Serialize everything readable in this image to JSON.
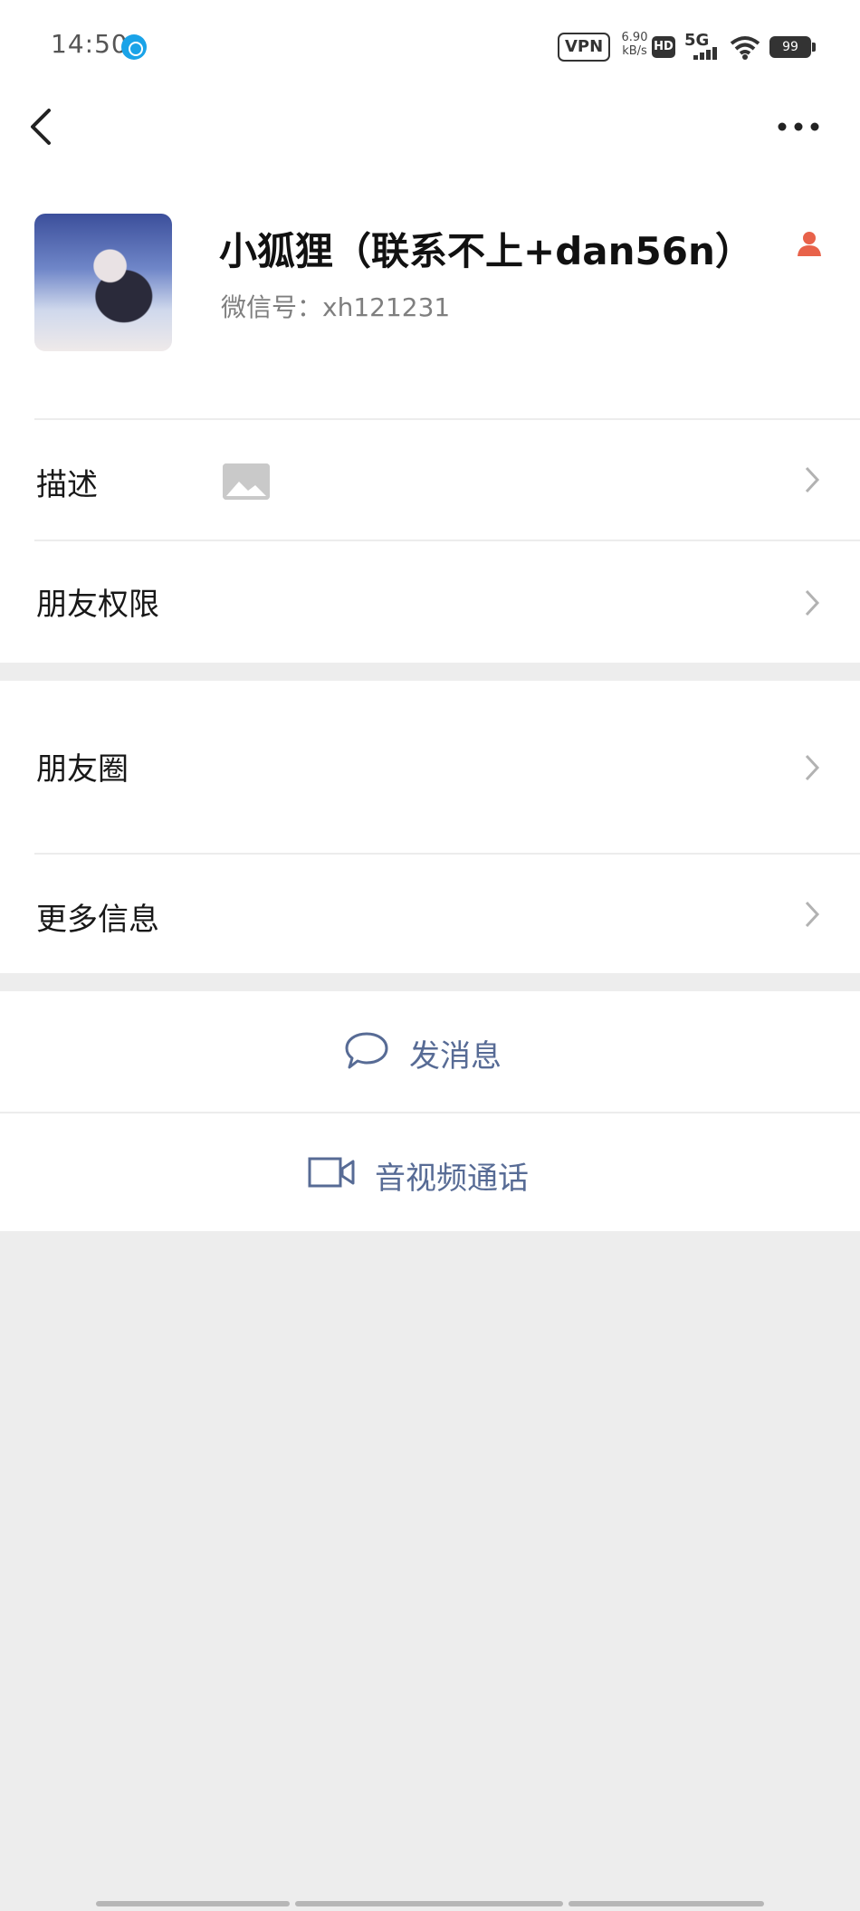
{
  "status_bar": {
    "time": "14:50",
    "vpn": "VPN",
    "speed": "6.90",
    "speed_unit": "kB/s",
    "hd": "HD",
    "network": "5G",
    "battery": "99"
  },
  "profile": {
    "name": "小狐狸（联系不上+dan56n）",
    "wechat_id": "微信号：xh121231"
  },
  "rows": {
    "description": "描述",
    "friend_permissions": "朋友权限",
    "moments": "朋友圈",
    "more_info": "更多信息"
  },
  "actions": {
    "send_message": "发消息",
    "video_call": "音视频通话"
  },
  "colors": {
    "link_blue": "#576b95",
    "background_gray": "#ededed",
    "gender_female": "#e8624a"
  }
}
